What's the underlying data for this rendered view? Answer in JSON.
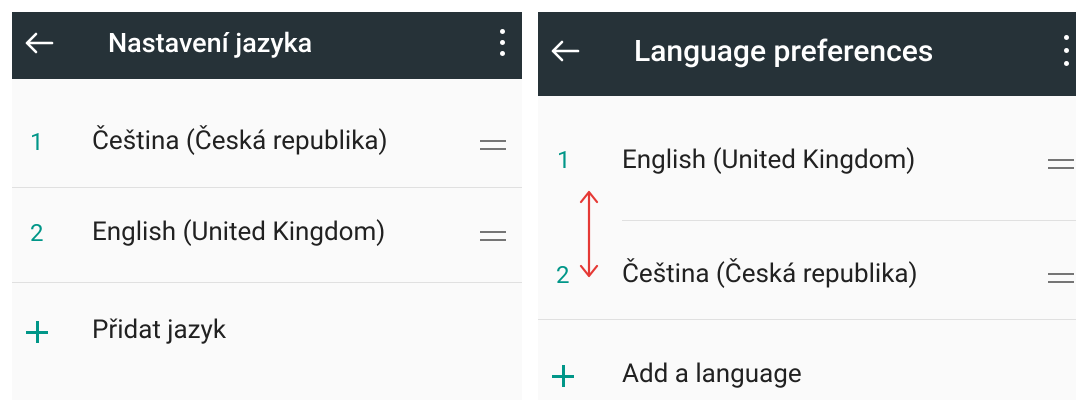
{
  "left_screen": {
    "toolbar": {
      "title": "Nastavení jazyka",
      "back_icon": "arrow-back-icon",
      "menu_icon": "more-vert-icon"
    },
    "languages": [
      {
        "number": "1",
        "label": "Čeština (Česká republika)"
      },
      {
        "number": "2",
        "label": "English (United Kingdom)"
      }
    ],
    "add_language_label": "Přidat jazyk"
  },
  "right_screen": {
    "toolbar": {
      "title": "Language preferences",
      "back_icon": "arrow-back-icon",
      "menu_icon": "more-vert-icon"
    },
    "languages": [
      {
        "number": "1",
        "label": "English (United Kingdom)"
      },
      {
        "number": "2",
        "label": "Čeština (Česká republika)"
      }
    ],
    "add_language_label": "Add a language",
    "reorder_indicator_icon": "swap-vertical-arrow-icon"
  },
  "colors": {
    "toolbar_bg": "#263238",
    "accent": "#009688",
    "annotation": "#e53935",
    "divider": "#e0e0e0"
  }
}
